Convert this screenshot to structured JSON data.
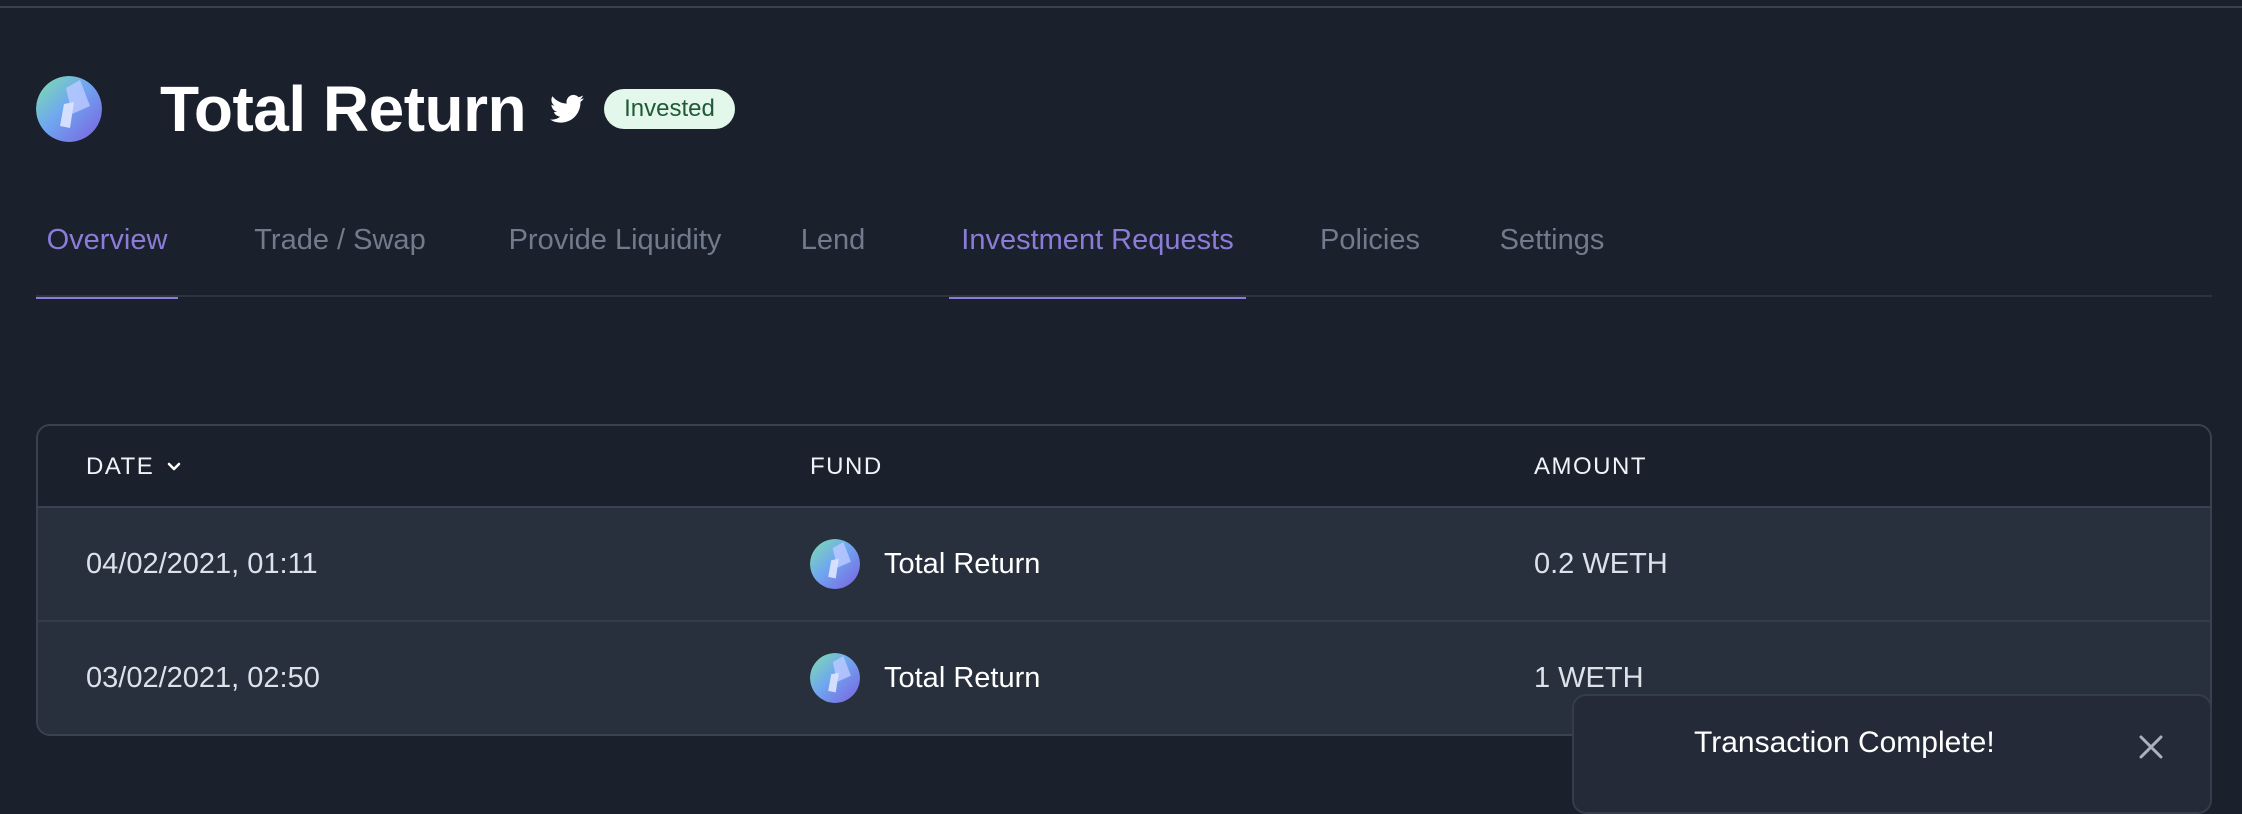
{
  "header": {
    "title": "Total Return",
    "status_badge": "Invested",
    "social_icon": "twitter-icon",
    "logo_icon": "fund-logo-icon"
  },
  "tabs": [
    {
      "label": "Overview",
      "active": true
    },
    {
      "label": "Trade / Swap",
      "active": false
    },
    {
      "label": "Provide Liquidity",
      "active": false
    },
    {
      "label": "Lend",
      "active": false
    },
    {
      "label": "Investment Requests",
      "active": true
    },
    {
      "label": "Policies",
      "active": false
    },
    {
      "label": "Settings",
      "active": false
    }
  ],
  "table": {
    "columns": {
      "date": "DATE",
      "fund": "FUND",
      "amount": "AMOUNT"
    },
    "sort_icon": "chevron-down-icon",
    "rows": [
      {
        "date": "04/02/2021, 01:11",
        "fund": "Total Return",
        "amount": "0.2 WETH"
      },
      {
        "date": "03/02/2021, 02:50",
        "fund": "Total Return",
        "amount": "1 WETH"
      }
    ]
  },
  "toast": {
    "title": "Transaction Complete!",
    "close_icon": "close-icon"
  },
  "colors": {
    "background": "#1a202c",
    "accent": "#8b7cd8",
    "badge_bg": "#e3f7ea",
    "badge_text": "#1f5a38",
    "row_bg": "#282f3d"
  }
}
